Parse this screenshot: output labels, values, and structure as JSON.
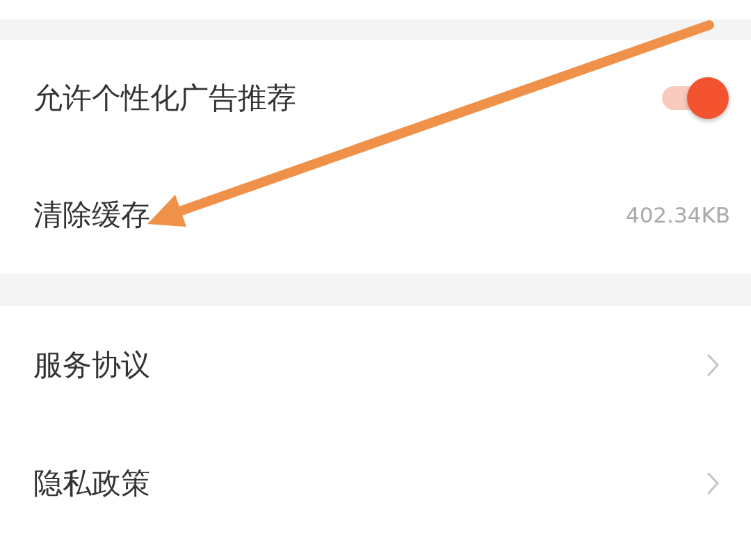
{
  "sections": [
    {
      "items": [
        {
          "kind": "toggle",
          "label": "允许个性化广告推荐",
          "on": true
        },
        {
          "kind": "value",
          "label": "清除缓存",
          "value": "402.34KB"
        }
      ]
    },
    {
      "items": [
        {
          "kind": "link",
          "label": "服务协议"
        },
        {
          "kind": "link",
          "label": "隐私政策"
        }
      ]
    }
  ]
}
